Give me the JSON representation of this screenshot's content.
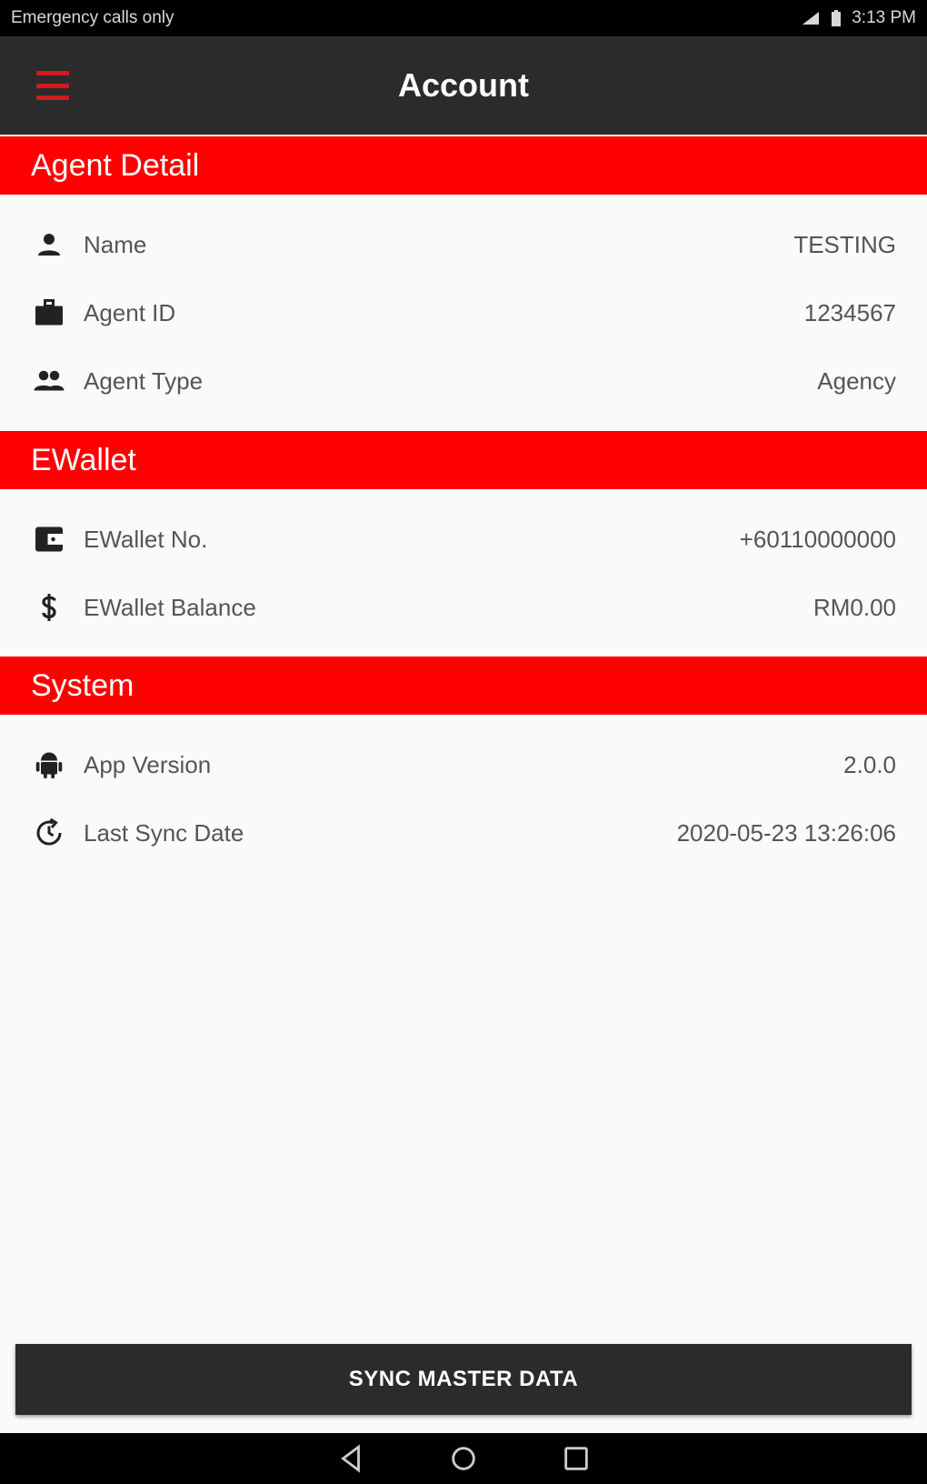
{
  "status_bar": {
    "left_text": "Emergency calls only",
    "right_text": "3:13 PM"
  },
  "app_bar": {
    "title": "Account",
    "menu_icon": "hamburger-menu-icon"
  },
  "sections": {
    "agent_detail": {
      "title": "Agent Detail",
      "rows": [
        {
          "icon": "person-icon",
          "label": "Name",
          "value": "TESTING"
        },
        {
          "icon": "briefcase-icon",
          "label": "Agent ID",
          "value": "1234567"
        },
        {
          "icon": "people-icon",
          "label": "Agent Type",
          "value": "Agency"
        }
      ]
    },
    "ewallet": {
      "title": "EWallet",
      "rows": [
        {
          "icon": "wallet-icon",
          "label": "EWallet No.",
          "value": "+60110000000"
        },
        {
          "icon": "dollar-icon",
          "label": "EWallet Balance",
          "value": "RM0.00"
        }
      ]
    },
    "system": {
      "title": "System",
      "rows": [
        {
          "icon": "android-icon",
          "label": "App Version",
          "value": "2.0.0"
        },
        {
          "icon": "clock-sync-icon",
          "label": "Last Sync Date",
          "value": "2020-05-23 13:26:06"
        }
      ]
    }
  },
  "actions": {
    "sync_button_label": "SYNC MASTER DATA"
  },
  "colors": {
    "accent": "#ff0000",
    "app_bar": "#2b2b2b",
    "menu_icon": "#d31a1a",
    "background": "#fafafa"
  }
}
